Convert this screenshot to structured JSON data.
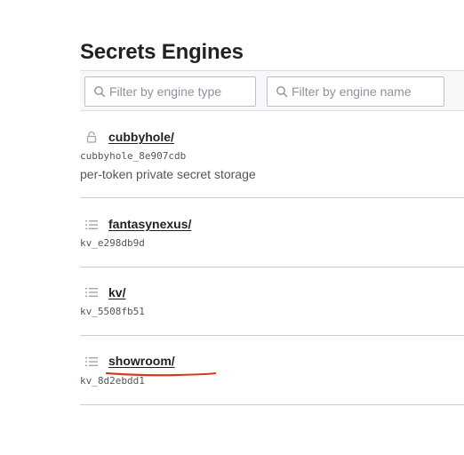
{
  "page": {
    "title": "Secrets Engines"
  },
  "filters": {
    "engine_type_placeholder": "Filter by engine type",
    "engine_name_placeholder": "Filter by engine name"
  },
  "engines": [
    {
      "path": "cubbyhole/",
      "accessor": "cubbyhole_8e907cdb",
      "description": "per-token private secret storage",
      "icon": "lock-icon"
    },
    {
      "path": "fantasynexus/",
      "accessor": "kv_e298db9d",
      "icon": "list-icon"
    },
    {
      "path": "kv/",
      "accessor": "kv_5508fb51",
      "icon": "list-icon"
    },
    {
      "path": "showroom/",
      "accessor": "kv_8d2ebdd1",
      "icon": "list-icon",
      "annotation": "red-hand-drawn-underline"
    }
  ],
  "colors": {
    "annotation_red": "#d63b1f",
    "toolbar_bg": "#f7f8fa",
    "divider": "#c9ccd1"
  }
}
